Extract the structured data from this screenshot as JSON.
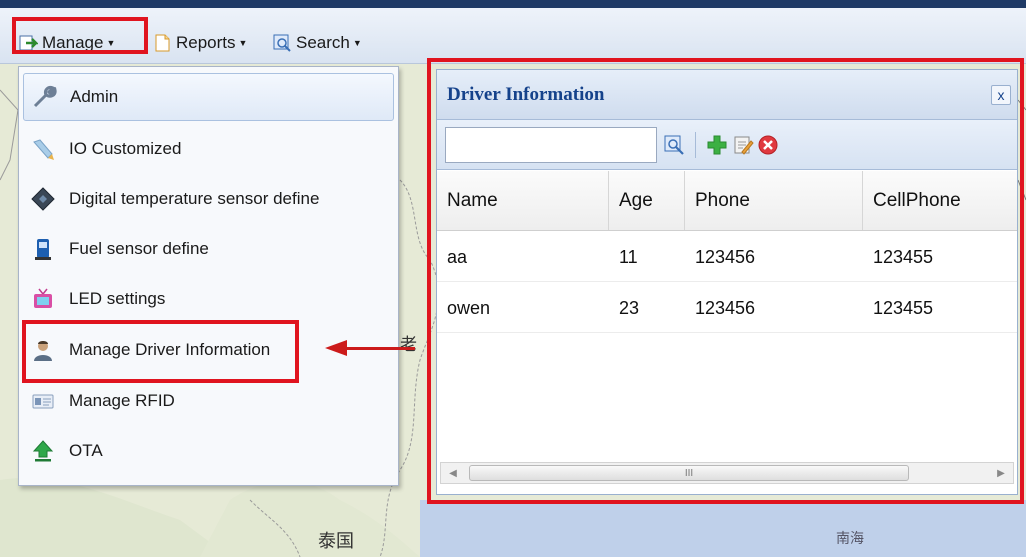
{
  "toolbar": {
    "manage_label": "Manage",
    "reports_label": "Reports",
    "search_label": "Search"
  },
  "menu": {
    "items": [
      {
        "label": "Admin",
        "icon": "wrench-icon"
      },
      {
        "label": "IO Customized",
        "icon": "pencil-icon"
      },
      {
        "label": "Digital temperature sensor define",
        "icon": "sensor-chip-icon"
      },
      {
        "label": "Fuel sensor define",
        "icon": "fuel-pump-icon"
      },
      {
        "label": "LED settings",
        "icon": "tv-icon"
      },
      {
        "label": "Manage Driver Information",
        "icon": "driver-icon"
      },
      {
        "label": "Manage RFID",
        "icon": "id-card-icon"
      },
      {
        "label": "OTA",
        "icon": "upload-arrow-icon"
      }
    ]
  },
  "panel": {
    "title": "Driver Information",
    "close_label": "x",
    "search_value": "",
    "columns": [
      "Name",
      "Age",
      "Phone",
      "CellPhone"
    ],
    "rows": [
      [
        "aa",
        "11",
        "123456",
        "123455"
      ],
      [
        "owen",
        "23",
        "123456",
        "123455"
      ]
    ],
    "scroll_grip": "III"
  },
  "map": {
    "label_thailand": "泰国",
    "label_scs": "南海",
    "label_laos": "老"
  },
  "colors": {
    "highlight": "#e0141f",
    "header_text": "#15428b",
    "arrow": "#cc1b1b"
  }
}
